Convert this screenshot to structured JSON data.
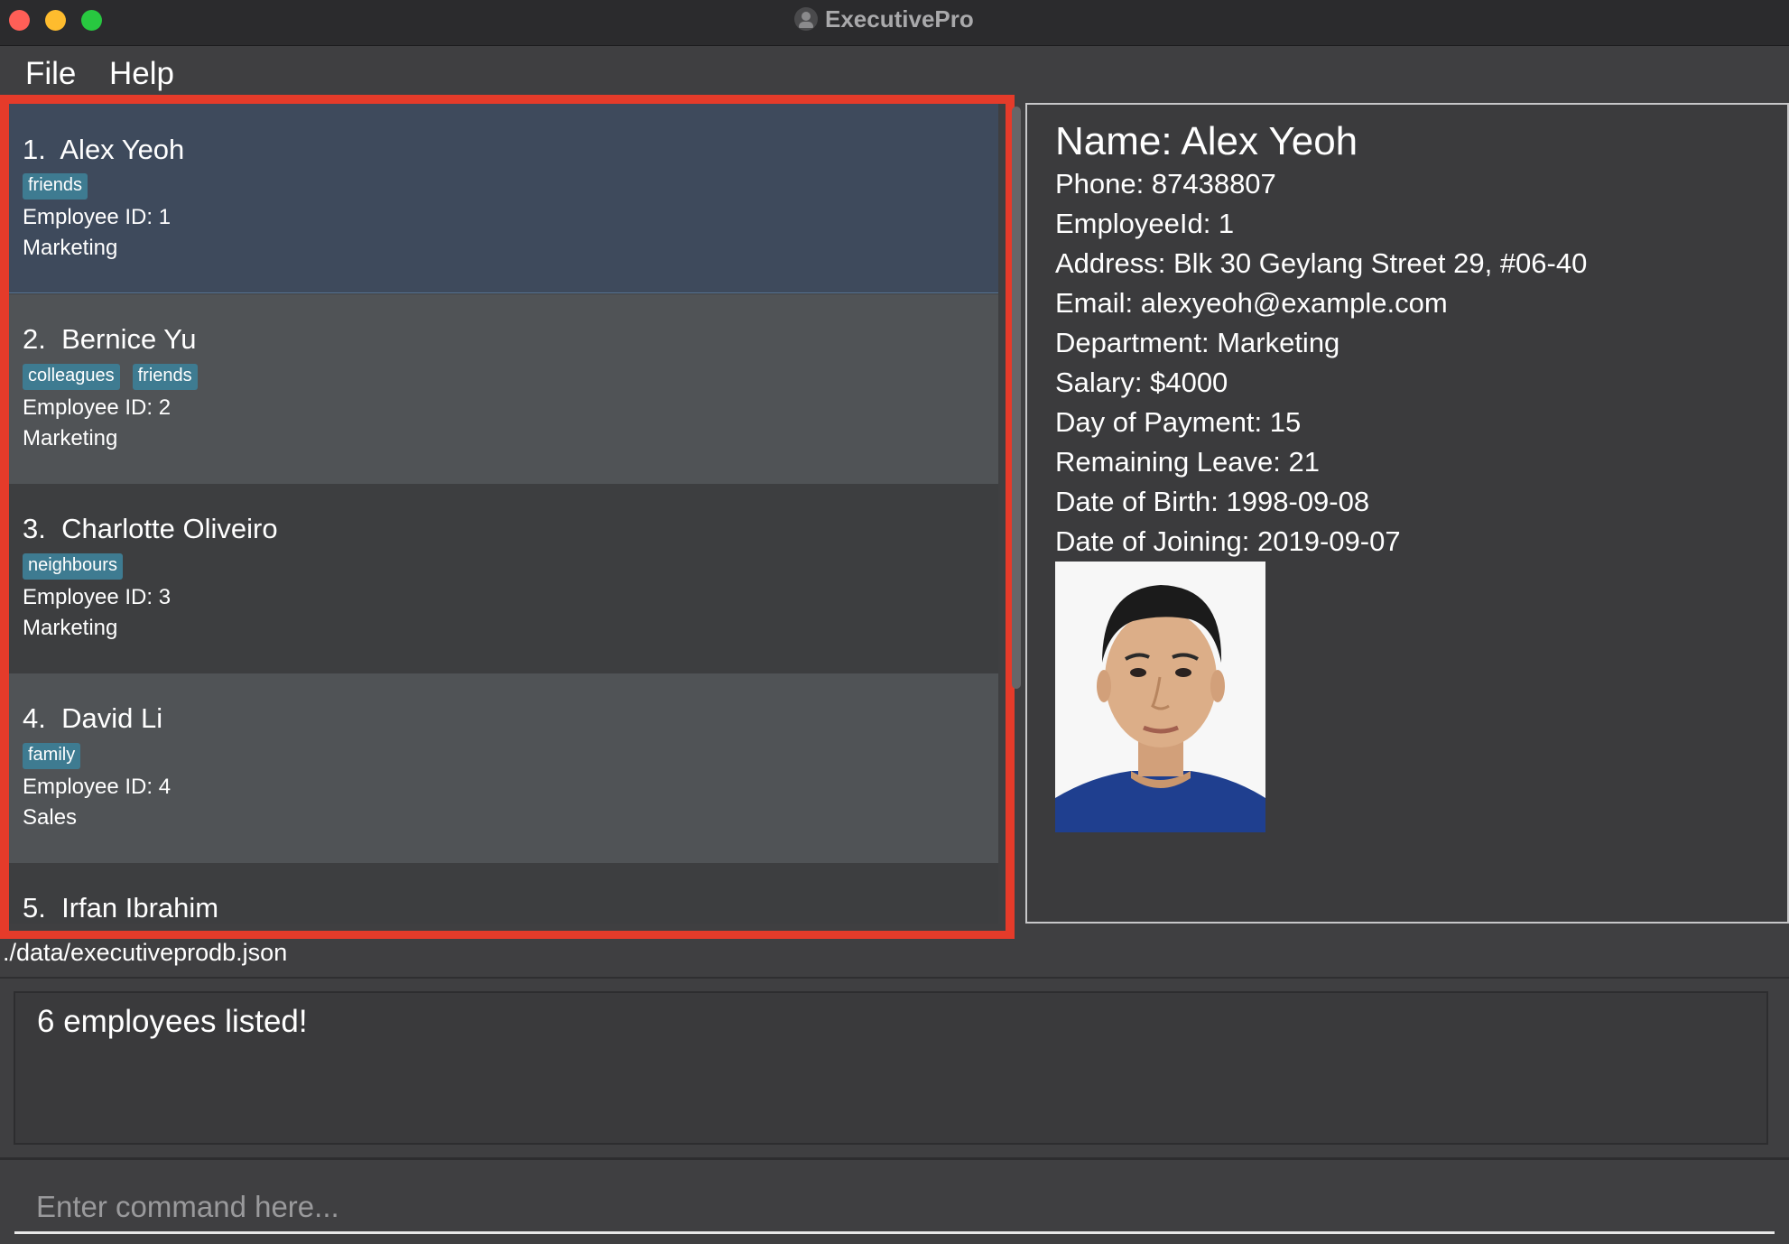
{
  "window": {
    "title": "ExecutivePro"
  },
  "menu": {
    "items": [
      {
        "label": "File"
      },
      {
        "label": "Help"
      }
    ]
  },
  "employees": [
    {
      "index": "1.",
      "name": "Alex Yeoh",
      "tags": [
        "friends"
      ],
      "id_line": "Employee ID: 1",
      "department": "Marketing"
    },
    {
      "index": "2.",
      "name": "Bernice Yu",
      "tags": [
        "colleagues",
        "friends"
      ],
      "id_line": "Employee ID: 2",
      "department": "Marketing"
    },
    {
      "index": "3.",
      "name": "Charlotte Oliveiro",
      "tags": [
        "neighbours"
      ],
      "id_line": "Employee ID: 3",
      "department": "Marketing"
    },
    {
      "index": "4.",
      "name": "David Li",
      "tags": [
        "family"
      ],
      "id_line": "Employee ID: 4",
      "department": "Sales"
    },
    {
      "index": "5.",
      "name": "Irfan Ibrahim"
    }
  ],
  "detail": {
    "name": "Name: Alex Yeoh",
    "lines": [
      "Phone: 87438807",
      "EmployeeId: 1",
      "Address: Blk 30 Geylang Street 29, #06-40",
      "Email: alexyeoh@example.com",
      "Department: Marketing",
      "Salary: $4000",
      "Day of Payment: 15",
      "Remaining Leave: 21",
      "Date of Birth: 1998-09-08",
      "Date of Joining: 2019-09-07"
    ]
  },
  "status": {
    "file_path": "./data/executiveprodb.json"
  },
  "result": {
    "message": "6 employees listed!"
  },
  "command": {
    "placeholder": "Enter command here..."
  },
  "colors": {
    "highlight_border": "#e53b2a",
    "tag_background": "#3e7b91",
    "selected_card": "#3e4a5c"
  }
}
